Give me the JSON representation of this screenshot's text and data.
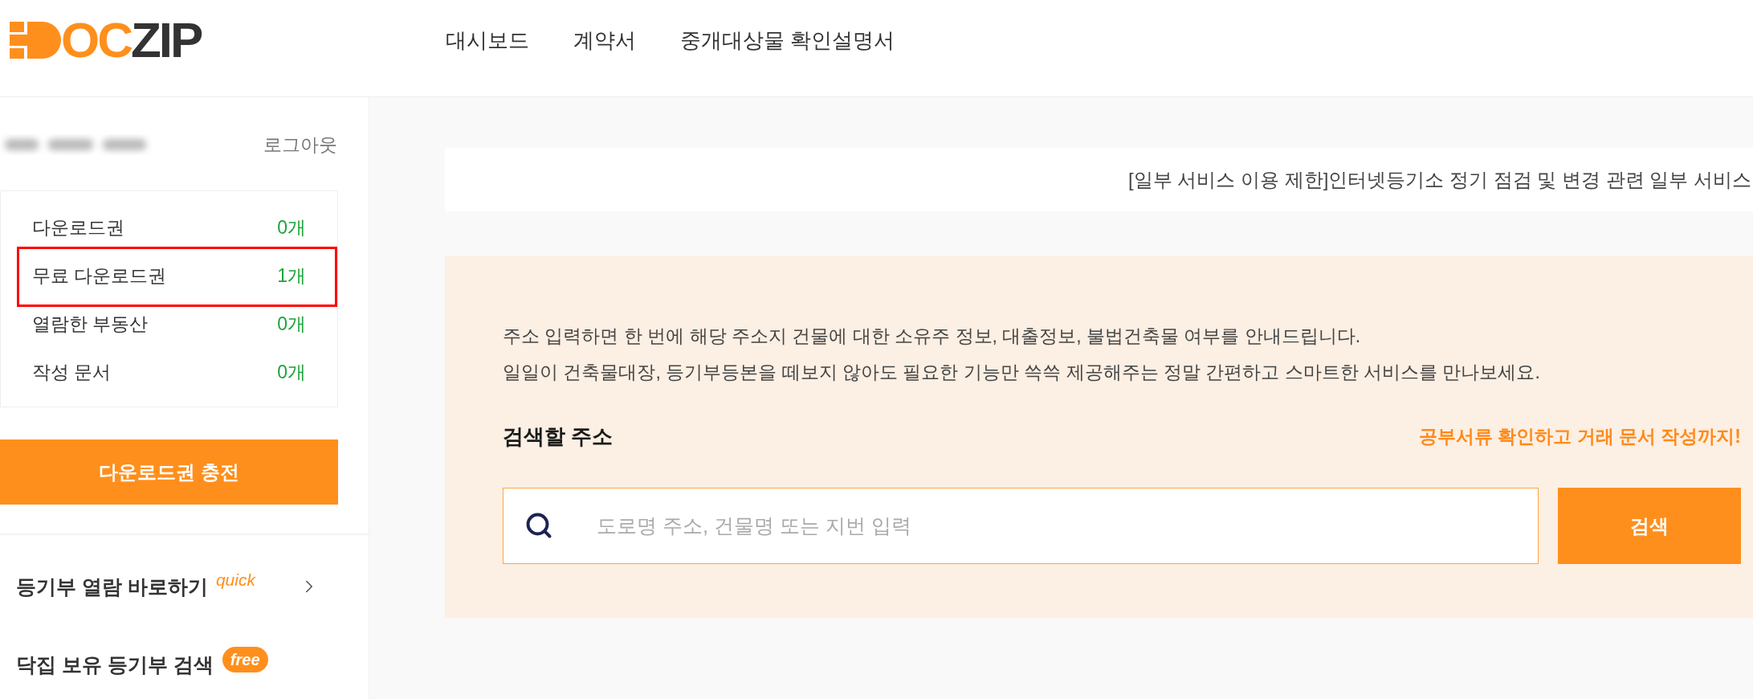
{
  "header": {
    "logo": {
      "accent": "OC",
      "text": "ZIP"
    },
    "nav": [
      "대시보드",
      "계약서",
      "중개대상물 확인설명서"
    ]
  },
  "sidebar": {
    "logout": "로그아웃",
    "stats": [
      {
        "label": "다운로드권",
        "value": "0개",
        "highlighted": false
      },
      {
        "label": "무료 다운로드권",
        "value": "1개",
        "highlighted": true
      },
      {
        "label": "열람한 부동산",
        "value": "0개",
        "highlighted": false
      },
      {
        "label": "작성 문서",
        "value": "0개",
        "highlighted": false
      }
    ],
    "charge_button": "다운로드권 충전",
    "links": [
      {
        "label": "등기부 열람 바로하기",
        "tag": "quick",
        "kind": "quick",
        "chevron": true
      },
      {
        "label": "닥집 보유 등기부 검색",
        "tag": "free",
        "kind": "free",
        "chevron": false
      }
    ]
  },
  "notice": {
    "text": "[일부 서비스 이용 제한]인터넷등기소 정기 점검 및 변경 관련 일부 서비스"
  },
  "banner": {
    "description": [
      "주소 입력하면 한 번에 해당 주소지 건물에 대한 소유주 정보, 대출정보, 불법건축물 여부를 안내드립니다.",
      "일일이 건축물대장, 등기부등본을 떼보지 않아도 필요한 기능만 쓱쓱 제공해주는 정말 간편하고 스마트한 서비스를 만나보세요."
    ],
    "search_label": "검색할 주소",
    "tagline": "공부서류 확인하고 거래 문서 작성까지!",
    "search": {
      "placeholder": "도로명 주소, 건물명 또는 지번 입력",
      "button": "검색"
    }
  }
}
